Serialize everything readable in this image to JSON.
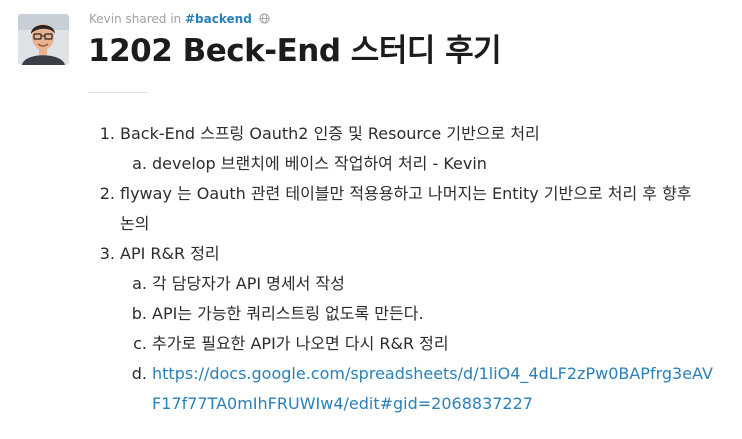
{
  "post": {
    "author": "Kevin",
    "shared_text": "shared in",
    "channel": "#backend",
    "title": "1202 Beck-End 스터디 후기"
  },
  "items": [
    {
      "marker": "1.",
      "text": "Back-End 스프링 Oauth2 인증 및 Resource 기반으로 처리"
    },
    {
      "marker": "a.",
      "text": "develop 브랜치에 베이스 작업하여 처리 - Kevin"
    },
    {
      "marker": "2.",
      "text": "flyway 는 Oauth 관련 테이블만 적용용하고 나머지는 Entity 기반으로 처리 후 향후"
    },
    {
      "text": "논의"
    },
    {
      "marker": "3.",
      "text": "API R&R 정리"
    },
    {
      "marker": "a.",
      "text": " 각 담당자가 API 명세서 작성"
    },
    {
      "marker": "b.",
      "text": " API는 가능한 쿼리스트링 없도록 만든다."
    },
    {
      "marker": "c.",
      "text": " 추가로 필요한 API가 나오면 다시 R&R 정리"
    },
    {
      "marker": "d.",
      "text": "https://docs.google.com/spreadsheets/d/1liO4_4dLF2zPw0BAPfrg3eAV"
    },
    {
      "text": "F17f77TA0mIhFRUWIw4/edit#gid=2068837227"
    }
  ],
  "icons": {
    "avatar": "user-avatar",
    "visibility": "globe-icon"
  },
  "colors": {
    "link": "#2a80b9",
    "meta": "#a0a0a2",
    "title": "#1d1c1d"
  }
}
